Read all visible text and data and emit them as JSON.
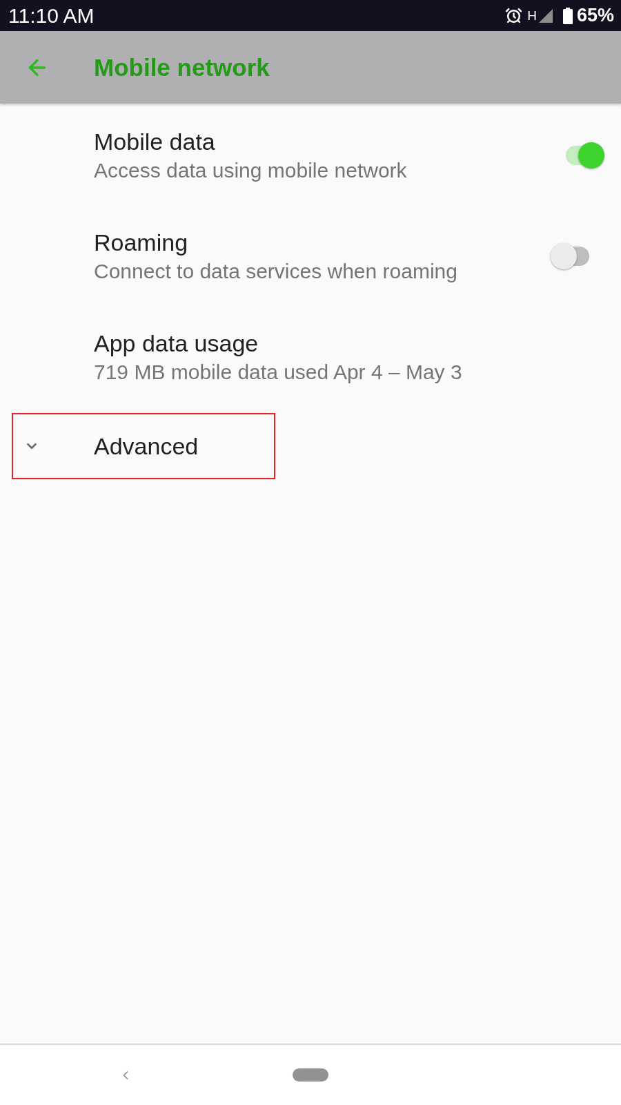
{
  "status_bar": {
    "time": "11:10 AM",
    "network": "H",
    "battery": "65%"
  },
  "app_bar": {
    "title": "Mobile network"
  },
  "settings": [
    {
      "kind": "switch",
      "title": "Mobile data",
      "summary": "Access data using mobile network",
      "on": true
    },
    {
      "kind": "switch",
      "title": "Roaming",
      "summary": "Connect to data services when roaming",
      "on": false
    },
    {
      "kind": "plain",
      "title": "App data usage",
      "summary": "719 MB mobile data used Apr 4 – May 3"
    }
  ],
  "advanced": {
    "label": "Advanced",
    "expanded": false,
    "highlighted": true
  }
}
